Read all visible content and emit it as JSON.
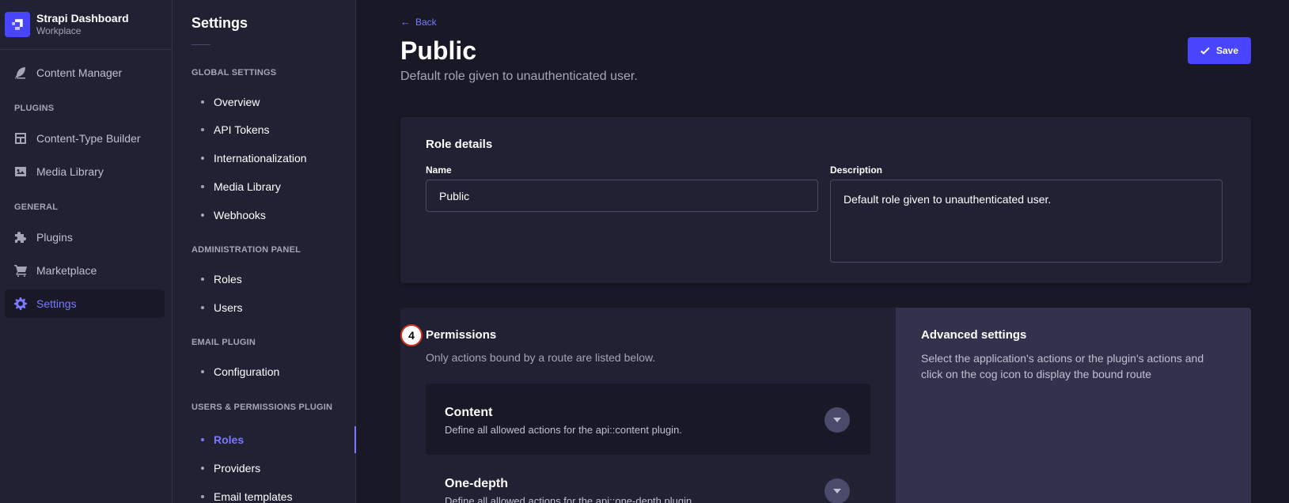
{
  "brand": {
    "title": "Strapi Dashboard",
    "subtitle": "Workplace"
  },
  "mainnav": {
    "content_manager": "Content Manager",
    "plugins_section": "PLUGINS",
    "content_type_builder": "Content-Type Builder",
    "media_library": "Media Library",
    "general_section": "GENERAL",
    "plugins": "Plugins",
    "marketplace": "Marketplace",
    "settings": "Settings"
  },
  "subnav": {
    "title": "Settings",
    "global_section": "GLOBAL SETTINGS",
    "global_items": [
      "Overview",
      "API Tokens",
      "Internationalization",
      "Media Library",
      "Webhooks"
    ],
    "admin_section": "ADMINISTRATION PANEL",
    "admin_items": [
      "Roles",
      "Users"
    ],
    "email_section": "EMAIL PLUGIN",
    "email_items": [
      "Configuration"
    ],
    "up_section": "USERS & PERMISSIONS PLUGIN",
    "up_items": [
      "Roles",
      "Providers",
      "Email templates"
    ]
  },
  "header": {
    "back_label": "Back",
    "title": "Public",
    "subtitle": "Default role given to unauthenticated user.",
    "save_label": "Save"
  },
  "role_details": {
    "title": "Role details",
    "name_label": "Name",
    "name_value": "Public",
    "description_label": "Description",
    "description_value": "Default role given to unauthenticated user."
  },
  "permissions": {
    "step_number": "4",
    "title": "Permissions",
    "subtitle": "Only actions bound by a route are listed below.",
    "sections": [
      {
        "title": "Content",
        "description": "Define all allowed actions for the api::content plugin."
      },
      {
        "title": "One-depth",
        "description": "Define all allowed actions for the api::one-depth plugin."
      }
    ]
  },
  "advanced": {
    "title": "Advanced settings",
    "text": "Select the application's actions or the plugin's actions and click on the cog icon to display the bound route"
  },
  "colors": {
    "accent": "#7b79ff",
    "primary": "#4945ff",
    "bg": "#181826",
    "panel": "#212134"
  }
}
